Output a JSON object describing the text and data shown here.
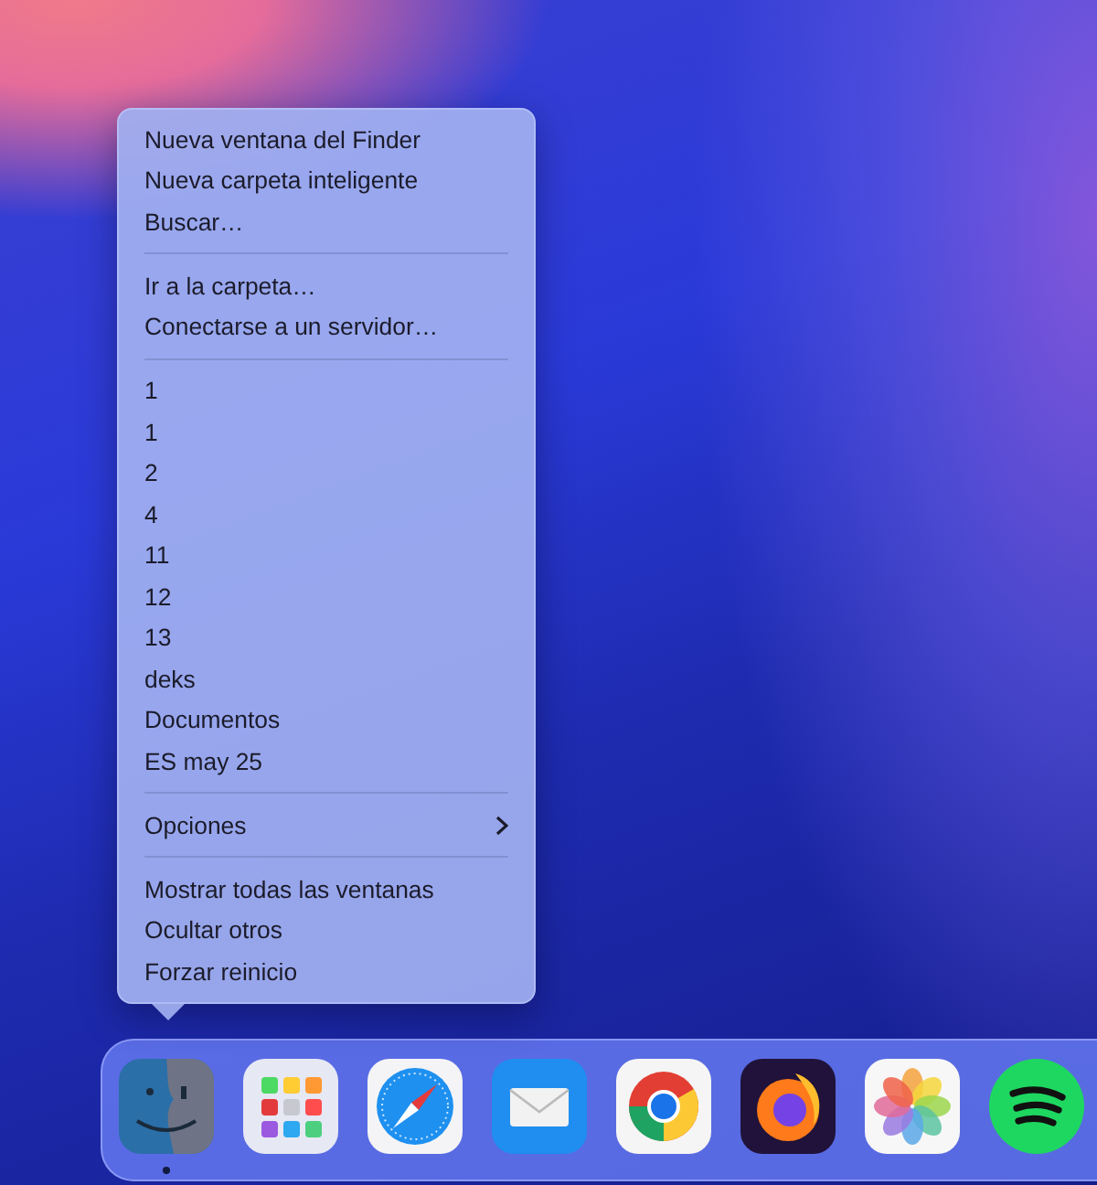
{
  "context_menu": {
    "sections": [
      {
        "items": [
          {
            "label": "Nueva ventana del Finder",
            "submenu": false
          },
          {
            "label": "Nueva carpeta inteligente",
            "submenu": false
          },
          {
            "label": "Buscar…",
            "submenu": false
          }
        ]
      },
      {
        "items": [
          {
            "label": "Ir a la carpeta…",
            "submenu": false
          },
          {
            "label": "Conectarse a un servidor…",
            "submenu": false
          }
        ]
      },
      {
        "items": [
          {
            "label": "1",
            "submenu": false
          },
          {
            "label": "1",
            "submenu": false
          },
          {
            "label": "2",
            "submenu": false
          },
          {
            "label": "4",
            "submenu": false
          },
          {
            "label": "11",
            "submenu": false
          },
          {
            "label": "12",
            "submenu": false
          },
          {
            "label": "13",
            "submenu": false
          },
          {
            "label": "deks",
            "submenu": false
          },
          {
            "label": "Documentos",
            "submenu": false
          },
          {
            "label": "ES may 25",
            "submenu": false
          }
        ]
      },
      {
        "items": [
          {
            "label": "Opciones",
            "submenu": true
          }
        ]
      },
      {
        "items": [
          {
            "label": "Mostrar todas las ventanas",
            "submenu": false
          },
          {
            "label": "Ocultar otros",
            "submenu": false
          },
          {
            "label": "Forzar reinicio",
            "submenu": false
          }
        ]
      }
    ]
  },
  "dock": {
    "apps": [
      {
        "running": true
      },
      {
        "running": false
      },
      {
        "running": false
      },
      {
        "running": false
      },
      {
        "running": false
      },
      {
        "running": false
      },
      {
        "running": false
      },
      {
        "running": false
      }
    ]
  }
}
